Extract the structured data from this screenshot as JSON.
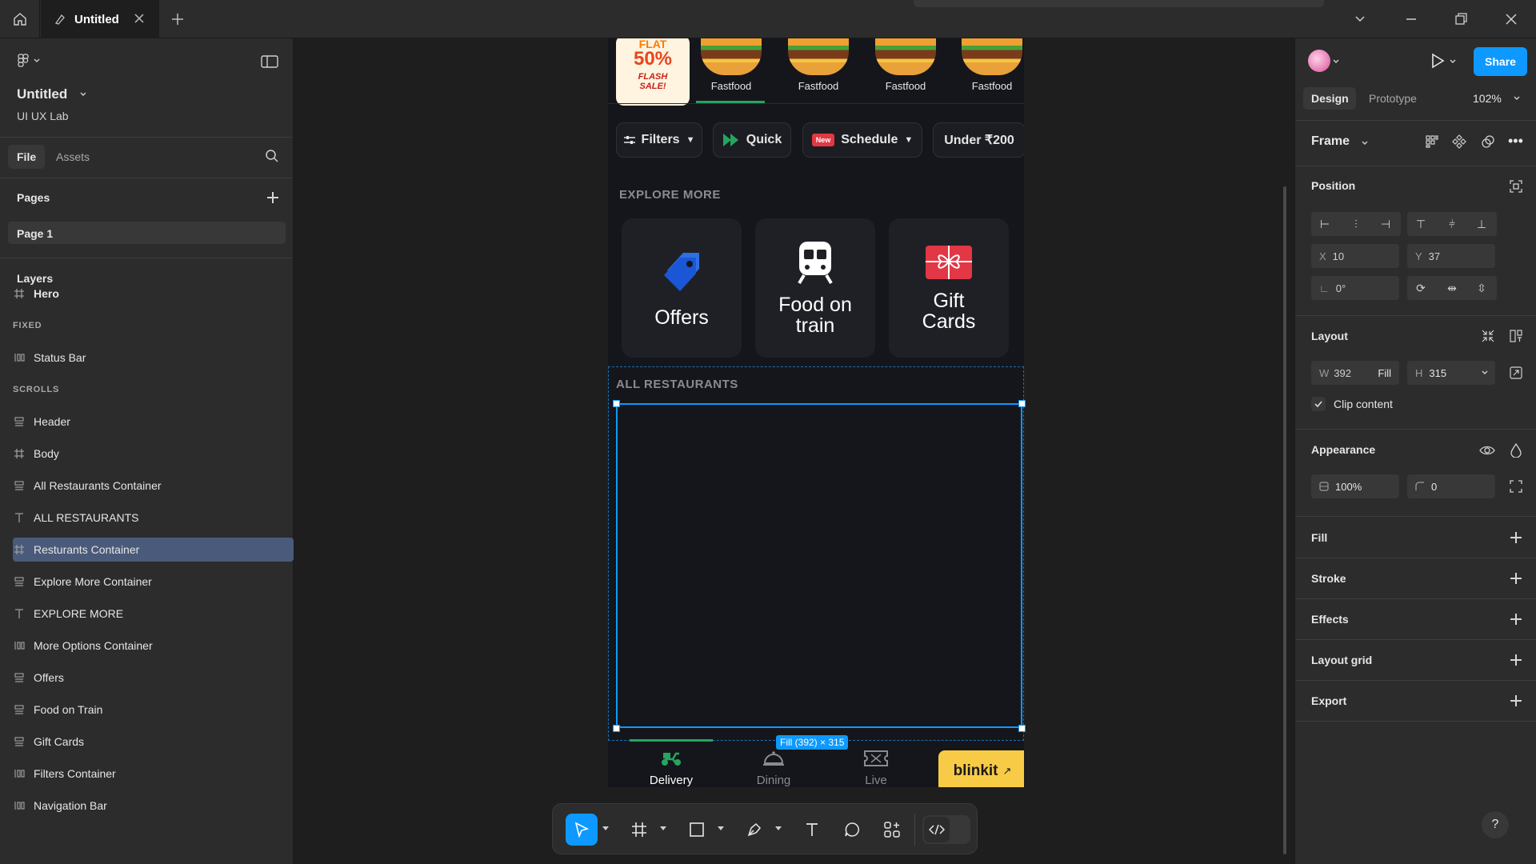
{
  "window": {
    "tab_title": "Untitled",
    "minimize_icon": "minimize-icon",
    "maximize_icon": "restore-icon",
    "close_icon": "close-icon"
  },
  "left_panel": {
    "file_name": "Untitled",
    "team_name": "UI UX Lab",
    "tabs": [
      "File",
      "Assets"
    ],
    "pages_heading": "Pages",
    "page_item": "Page 1",
    "layers_heading": "Layers",
    "layers": [
      {
        "name": "Hero",
        "icon": "frame-icon",
        "indent": 0,
        "bold": true
      },
      {
        "name": "FIXED",
        "icon": "",
        "indent": 1,
        "caps": true
      },
      {
        "name": "Status Bar",
        "icon": "auto-layout-horizontal-icon",
        "indent": 1
      },
      {
        "name": "SCROLLS",
        "icon": "",
        "indent": 1,
        "caps": true
      },
      {
        "name": "Header",
        "icon": "auto-layout-vertical-icon",
        "indent": 1
      },
      {
        "name": "Body",
        "icon": "frame-icon",
        "indent": 1
      },
      {
        "name": "All Restaurants Container",
        "icon": "auto-layout-vertical-icon",
        "indent": 2
      },
      {
        "name": "ALL RESTAURANTS",
        "icon": "text-icon",
        "indent": 3
      },
      {
        "name": "Resturants Container",
        "icon": "frame-icon",
        "indent": 3,
        "selected": true
      },
      {
        "name": "Explore More Container",
        "icon": "auto-layout-vertical-icon",
        "indent": 2
      },
      {
        "name": "EXPLORE MORE",
        "icon": "text-icon",
        "indent": 3
      },
      {
        "name": "More Options Container",
        "icon": "auto-layout-horizontal-icon",
        "indent": 3
      },
      {
        "name": "Offers",
        "icon": "auto-layout-vertical-icon",
        "indent": 4
      },
      {
        "name": "Food on Train",
        "icon": "auto-layout-vertical-icon",
        "indent": 4
      },
      {
        "name": "Gift Cards",
        "icon": "auto-layout-vertical-icon",
        "indent": 4
      },
      {
        "name": "Filters Container",
        "icon": "auto-layout-horizontal-icon",
        "indent": 2
      },
      {
        "name": "Navigation Bar",
        "icon": "auto-layout-horizontal-icon",
        "indent": 1
      }
    ]
  },
  "right_panel": {
    "share_label": "Share",
    "tabs": [
      "Design",
      "Prototype"
    ],
    "zoom": "102%",
    "frame_label": "Frame",
    "position_heading": "Position",
    "x_label": "X",
    "x_value": "10",
    "y_label": "Y",
    "y_value": "37",
    "rotation_value": "0°",
    "layout_heading": "Layout",
    "w_label": "W",
    "w_value": "392",
    "w_mode": "Fill",
    "h_label": "H",
    "h_value": "315",
    "clip_content_label": "Clip content",
    "appearance_heading": "Appearance",
    "opacity_value": "100%",
    "radius_value": "0",
    "sections": [
      "Fill",
      "Stroke",
      "Effects",
      "Layout grid",
      "Export"
    ],
    "help_label": "?"
  },
  "phone": {
    "flash_sale_top": "FLAT",
    "flash_sale_pct": "50%",
    "flash_sale_bottom": "FLASH SALE!",
    "categories": [
      "Fastfood",
      "Fastfood",
      "Fastfood",
      "Fastfood"
    ],
    "filters": [
      {
        "label": "Filters",
        "icon": "sliders-icon"
      },
      {
        "label": "Quick",
        "icon": "fast-forward-icon"
      },
      {
        "label": "Schedule",
        "badge": "New"
      },
      {
        "label": "Under ₹200"
      }
    ],
    "explore_more_title": "EXPLORE MORE",
    "explore_tiles": [
      {
        "label": "Offers",
        "icon": "tag-icon"
      },
      {
        "label": "Food on train",
        "icon": "train-icon"
      },
      {
        "label": "Gift Cards",
        "icon": "gift-icon"
      }
    ],
    "all_restaurants_title": "ALL RESTAURANTS",
    "size_tag": "Fill (392) × 315",
    "nav": [
      {
        "label": "Delivery",
        "icon": "scooter-icon",
        "active": true
      },
      {
        "label": "Dining",
        "icon": "cloche-icon"
      },
      {
        "label": "Live",
        "icon": "ticket-icon"
      }
    ],
    "blinkit_label": "blinkit",
    "blinkit_accent": "it"
  },
  "colors": {
    "accent": "#0d99ff",
    "selected_layer": "#4a5a7a",
    "blinkit_yellow": "#f8cb46",
    "delivery_green": "#25a55f"
  }
}
